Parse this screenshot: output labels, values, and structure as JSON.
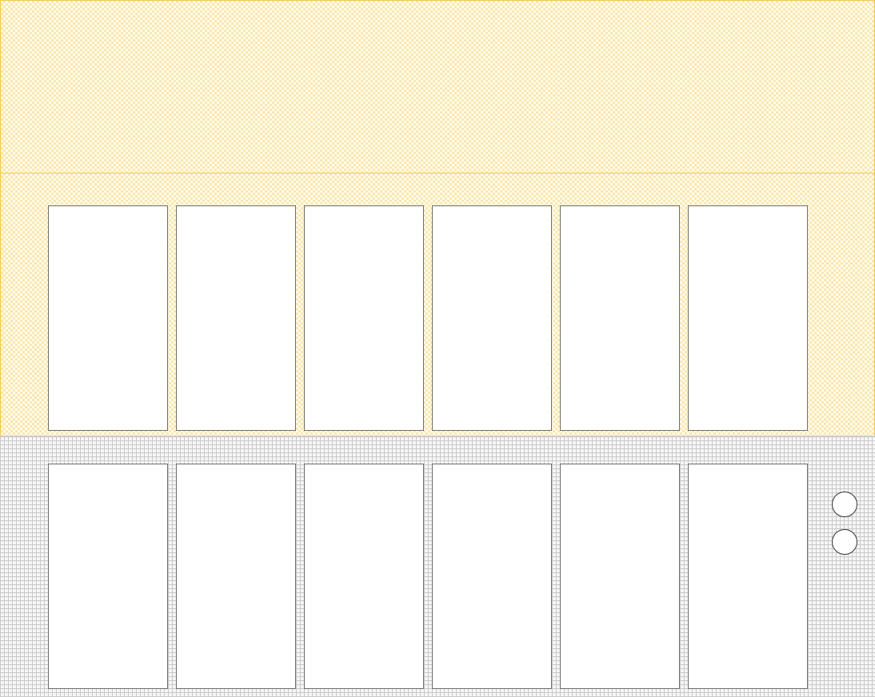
{
  "board": {
    "top_area": {},
    "opponent_row": {
      "cards": [
        "",
        "",
        "",
        "",
        "",
        ""
      ]
    },
    "player_row": {
      "cards": [
        "",
        "",
        "",
        "",
        "",
        ""
      ]
    },
    "controls": {
      "buttons": [
        "",
        ""
      ]
    }
  }
}
